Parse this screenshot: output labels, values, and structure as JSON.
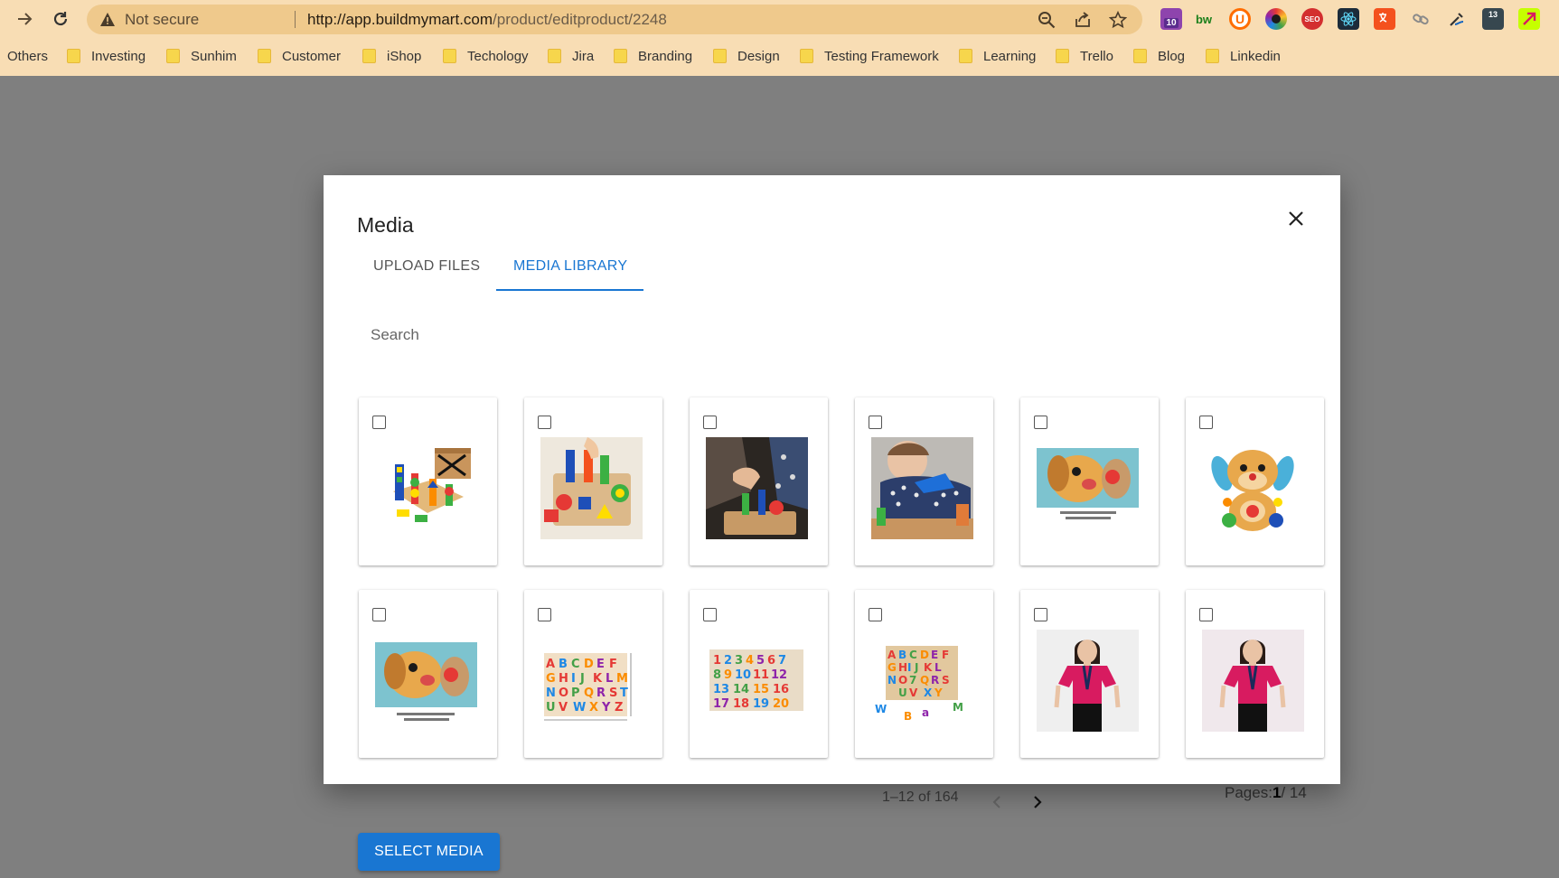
{
  "browser": {
    "security_text": "Not secure",
    "url_host": "http://app.buildmymart.com",
    "url_path": "/product/editproduct/2248",
    "extension_badges": [
      "10",
      "bw",
      "U",
      "SEO",
      "13"
    ]
  },
  "bookmarks": [
    "Others",
    "Investing",
    "Sunhim",
    "Customer",
    "iShop",
    "Techology",
    "Jira",
    "Branding",
    "Design",
    "Testing Framework",
    "Learning",
    "Trello",
    "Blog",
    "Linkedin"
  ],
  "modal": {
    "title": "Media",
    "tabs": [
      {
        "label": "UPLOAD FILES",
        "active": false
      },
      {
        "label": "MEDIA LIBRARY",
        "active": true
      }
    ],
    "search_placeholder": "Search",
    "items": [
      {
        "kind": "shape-sorter-box",
        "selected": false
      },
      {
        "kind": "shape-sorter-hand",
        "selected": false
      },
      {
        "kind": "shape-sorter-child-dark",
        "selected": false
      },
      {
        "kind": "shape-sorter-child",
        "selected": false
      },
      {
        "kind": "plush-puppy-closeup",
        "selected": false
      },
      {
        "kind": "plush-puppy",
        "selected": false
      },
      {
        "kind": "plush-puppy-closeup-2",
        "selected": false
      },
      {
        "kind": "alphabet-puzzle",
        "selected": false
      },
      {
        "kind": "number-puzzle",
        "selected": false
      },
      {
        "kind": "alphabet-puzzle-letters",
        "selected": false
      },
      {
        "kind": "girl-pink-top",
        "selected": false
      },
      {
        "kind": "girl-pink-top-2",
        "selected": false
      }
    ]
  },
  "pagination": {
    "range_text": "1–12 of 164",
    "pages_label": "Pages:",
    "current_page": "1",
    "total_pages": "/ 14"
  },
  "select_media_label": "SELECT MEDIA",
  "colors": {
    "accent": "#1976d2",
    "chrome_bg": "#f8ddb4",
    "omnibox_bg": "#efc98c",
    "overlay": "#7f7f7f"
  }
}
